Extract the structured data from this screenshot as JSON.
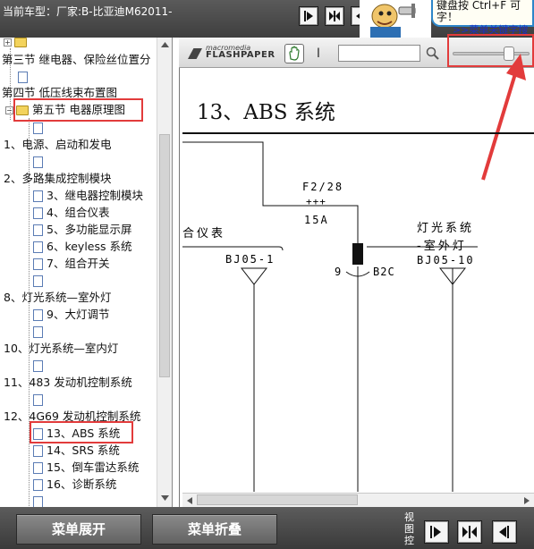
{
  "header": {
    "car_model": "当前车型：厂家:B-比亚迪M62011-"
  },
  "tip": {
    "line1": "键盘按 Ctrl+F 可",
    "line2": "字！",
    "link": ">>菜单关键字搜"
  },
  "tree": {
    "items": [
      {
        "label": "",
        "type": "folder"
      },
      {
        "label": "第三节 继电器、保险丝位置分",
        "type": "text"
      },
      {
        "label": "",
        "type": "node"
      },
      {
        "label": "第四节 低压线束布置图",
        "type": "text"
      },
      {
        "label": "第五节 电器原理图",
        "type": "folder-open"
      },
      {
        "label": "",
        "type": "node"
      },
      {
        "label": "1、电源、启动和发电",
        "type": "text"
      },
      {
        "label": "",
        "type": "node"
      },
      {
        "label": "2、多路集成控制模块",
        "type": "text"
      },
      {
        "label": "3、继电器控制模块",
        "type": "node"
      },
      {
        "label": "4、组合仪表",
        "type": "node"
      },
      {
        "label": "5、多功能显示屏",
        "type": "node"
      },
      {
        "label": "6、keyless 系统",
        "type": "node"
      },
      {
        "label": "7、组合开关",
        "type": "node"
      },
      {
        "label": "",
        "type": "node"
      },
      {
        "label": "8、灯光系统—室外灯",
        "type": "text"
      },
      {
        "label": "9、大灯调节",
        "type": "node"
      },
      {
        "label": "",
        "type": "node"
      },
      {
        "label": "10、灯光系统—室内灯",
        "type": "text"
      },
      {
        "label": "",
        "type": "node"
      },
      {
        "label": "11、483 发动机控制系统",
        "type": "text"
      },
      {
        "label": "",
        "type": "node"
      },
      {
        "label": "12、4G69 发动机控制系统",
        "type": "text"
      },
      {
        "label": "13、ABS 系统",
        "type": "node"
      },
      {
        "label": "14、SRS 系统",
        "type": "node"
      },
      {
        "label": "15、倒车雷达系统",
        "type": "node"
      },
      {
        "label": "16、诊断系统",
        "type": "node"
      },
      {
        "label": "",
        "type": "node"
      }
    ]
  },
  "viewer": {
    "logo_top": "macromedia",
    "logo": "FLASHPAPER",
    "text_tool": "I",
    "search_value": "",
    "zoom_level": 0.75
  },
  "document": {
    "title": "13、ABS 系统",
    "fuse_label": "F2/28",
    "fuse_marks": "+++",
    "fuse_rating": "15A",
    "left_label": "合仪表",
    "left_connector": "BJ05-1",
    "mid_pin": "9",
    "mid_connector": "B2C",
    "right_label_1": "灯光系统",
    "right_label_2": "-室外灯",
    "right_connector": "BJ05-10"
  },
  "bottom": {
    "expand_label": "菜单展开",
    "collapse_label": "菜单折叠",
    "view_label": "视图控"
  },
  "colors": {
    "highlight": "#e23b3b",
    "link": "#1c2fc4",
    "bar": "#4a4a4a"
  }
}
